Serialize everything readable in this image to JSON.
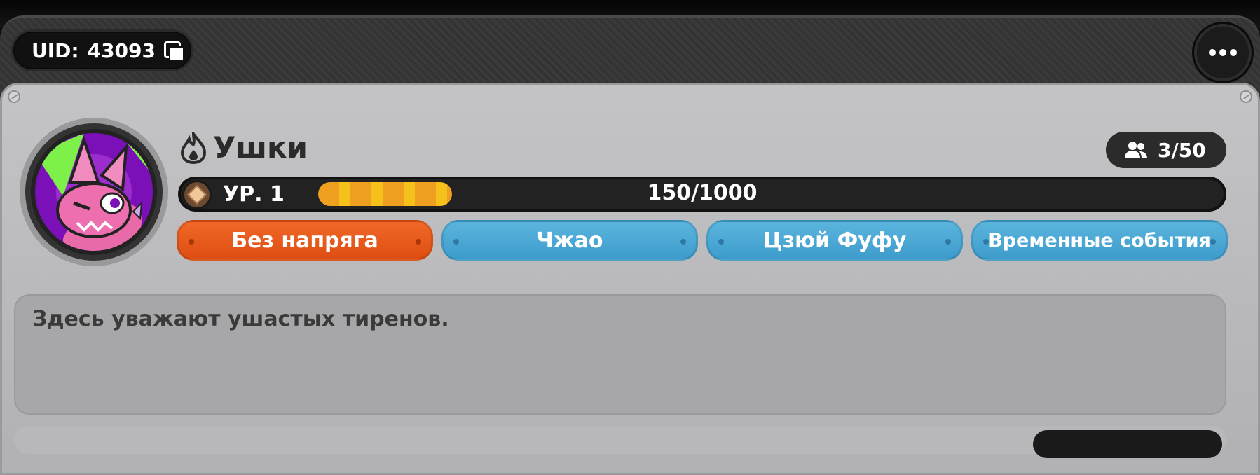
{
  "header": {
    "uid_label": "UID:",
    "uid_value": "43093"
  },
  "guild": {
    "name": "Ушки",
    "level_label": "УР. 1",
    "xp_current": 150,
    "xp_max": 1000,
    "xp_text": "150/1000",
    "members": "3/50",
    "tags": [
      {
        "label": "Без напряга",
        "color": "#e8581c"
      },
      {
        "label": "Чжао",
        "color": "#4ea8d6"
      },
      {
        "label": "Цзюй Фуфу",
        "color": "#4ea8d6"
      },
      {
        "label": "Временные события",
        "color": "#4ea8d6"
      }
    ],
    "description": "Здесь уважают ушастых тиренов."
  },
  "icons": [
    "copy-icon",
    "more-icon",
    "flame-icon",
    "members-icon",
    "level-badge-icon"
  ]
}
